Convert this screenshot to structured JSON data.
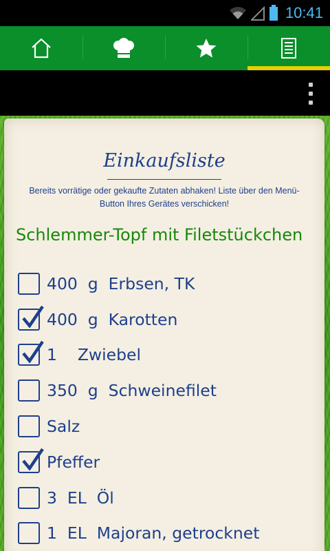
{
  "status_bar": {
    "time": "10:41",
    "icons": [
      "wifi-icon",
      "signal-icon",
      "battery-icon"
    ]
  },
  "tabs": [
    {
      "name": "home",
      "icon": "home-icon",
      "selected": false
    },
    {
      "name": "recipes",
      "icon": "chef-hat-icon",
      "selected": false
    },
    {
      "name": "favorites",
      "icon": "star-icon",
      "selected": false
    },
    {
      "name": "shopping-list",
      "icon": "list-icon",
      "selected": true
    }
  ],
  "action_bar": {
    "menu_icon": "overflow-menu-icon"
  },
  "colors": {
    "tab_bar": "#0a8f2a",
    "tab_indicator": "#e6cf00",
    "text_blue": "#1e3f8c",
    "recipe_green": "#18880a",
    "status_time": "#4fb8f0"
  },
  "shopping_list": {
    "title": "Einkaufsliste",
    "hint": "Bereits vorrätige oder gekaufte Zutaten abhaken! Liste über den Menü-Button Ihres Gerätes verschicken!",
    "recipe_title": "Schlemmer-Topf mit Filetstückchen",
    "items": [
      {
        "text": "400  g  Erbsen, TK",
        "checked": false
      },
      {
        "text": "400  g  Karotten",
        "checked": true
      },
      {
        "text": "1    Zwiebel",
        "checked": true
      },
      {
        "text": "350  g  Schweinefilet",
        "checked": false
      },
      {
        "text": "Salz",
        "checked": false
      },
      {
        "text": "Pfeffer",
        "checked": true
      },
      {
        "text": "3  EL  Öl",
        "checked": false
      },
      {
        "text": "1  EL  Majoran, getrocknet",
        "checked": false
      }
    ]
  }
}
